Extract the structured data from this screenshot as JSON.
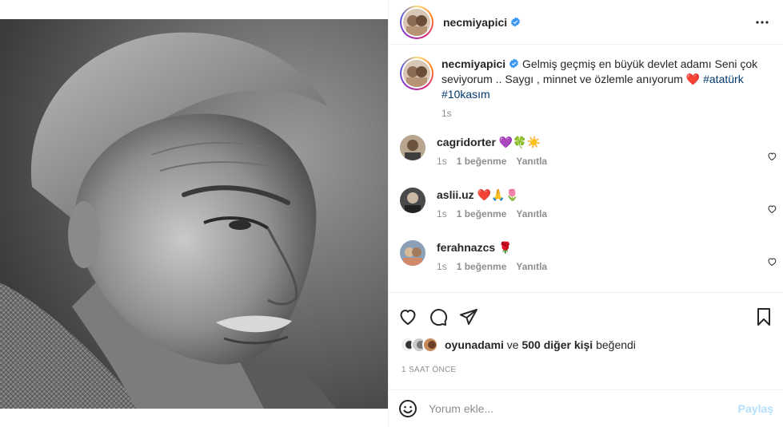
{
  "post": {
    "username": "necmiyapici",
    "verified": true,
    "caption": "Gelmiş geçmiş en büyük devlet adamı Seni çok seviyorum .. Saygı , minnet ve özlemle anıyorum ❤️",
    "hashtags": [
      "#atatürk",
      "#10kasım"
    ],
    "caption_time": "1s"
  },
  "comments": [
    {
      "username": "cagridorter",
      "text": "💜🍀☀️",
      "time": "1s",
      "likes": "1 beğenme",
      "reply": "Yanıtla"
    },
    {
      "username": "aslii.uz",
      "text": "❤️🙏🌷",
      "time": "1s",
      "likes": "1 beğenme",
      "reply": "Yanıtla"
    },
    {
      "username": "ferahnazcs",
      "text": "🌹",
      "time": "1s",
      "likes": "1 beğenme",
      "reply": "Yanıtla"
    }
  ],
  "likes": {
    "first_user": "oyunadami",
    "connector": "ve",
    "others": "500 diğer kişi",
    "suffix": "beğendi"
  },
  "time_ago": "1 SAAT ÖNCE",
  "comment_box": {
    "placeholder": "Yorum ekle...",
    "share_label": "Paylaş"
  },
  "colors": {
    "verified": "#3897f0",
    "hashtag": "#00376b",
    "muted": "#8e8e8e",
    "share_disabled": "#b2dffc"
  },
  "icons": [
    "more-options-icon",
    "heart-icon",
    "comment-icon",
    "share-icon",
    "bookmark-icon",
    "emoji-icon",
    "verified-icon"
  ]
}
